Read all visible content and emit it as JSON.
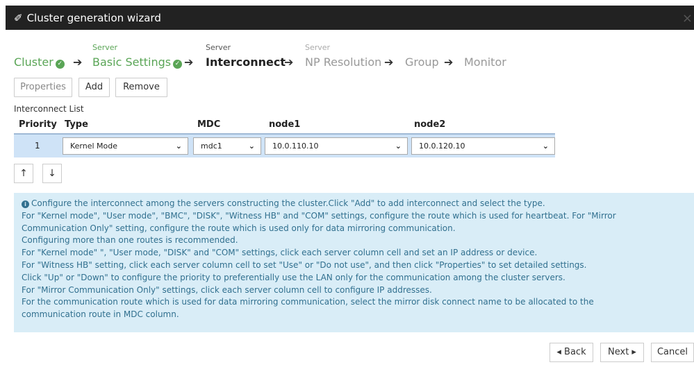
{
  "window": {
    "title": "Cluster generation wizard",
    "close": "×"
  },
  "steps": [
    {
      "sup": "",
      "label": "Cluster",
      "state": "done"
    },
    {
      "sup": "Server",
      "label": "Basic Settings",
      "state": "done"
    },
    {
      "sup": "Server",
      "label": "Interconnect",
      "state": "current"
    },
    {
      "sup": "Server",
      "label": "NP Resolution",
      "state": "todo"
    },
    {
      "sup": "",
      "label": "Group",
      "state": "todo"
    },
    {
      "sup": "",
      "label": "Monitor",
      "state": "todo"
    }
  ],
  "toolbar": {
    "properties": "Properties",
    "add": "Add",
    "remove": "Remove"
  },
  "interconnect": {
    "list_label": "Interconnect List",
    "columns": [
      "Priority",
      "Type",
      "MDC",
      "node1",
      "node2"
    ],
    "rows": [
      {
        "priority": "1",
        "type": "Kernel Mode",
        "mdc": "mdc1",
        "node1": "10.0.110.10",
        "node2": "10.0.120.10"
      }
    ]
  },
  "order": {
    "up": "↑",
    "down": "↓"
  },
  "info_lines": [
    "Configure the interconnect among the servers constructing the cluster.Click \"Add\" to add interconnect and select the type.",
    "For \"Kernel mode\", \"User mode\", \"BMC\", \"DISK\", \"Witness HB\" and \"COM\" settings, configure the route which is used for heartbeat. For \"Mirror",
    "Communication Only\" setting, configure the route which is used only for data mirroring communication.",
    "Configuring more than one routes is recommended.",
    "For \"Kernel mode\" \", \"User mode, \"DISK\" and \"COM\" settings, click each server column cell and set an IP address or device.",
    "For \"Witness HB\" setting, click each server column cell to set \"Use\" or \"Do not use\", and then click \"Properties\" to set detailed settings.",
    "Click \"Up\" or \"Down\" to configure the priority to preferentially use the LAN only for the communication among the cluster servers.",
    "For \"Mirror Communication Only\" settings, click each server column cell to configure IP addresses.",
    "For the communication route which is used for data mirroring communication, select the mirror disk connect name to be allocated to the",
    "communication route in MDC column."
  ],
  "footer": {
    "back": "◂ Back",
    "next": "Next ▸",
    "cancel": "Cancel"
  }
}
